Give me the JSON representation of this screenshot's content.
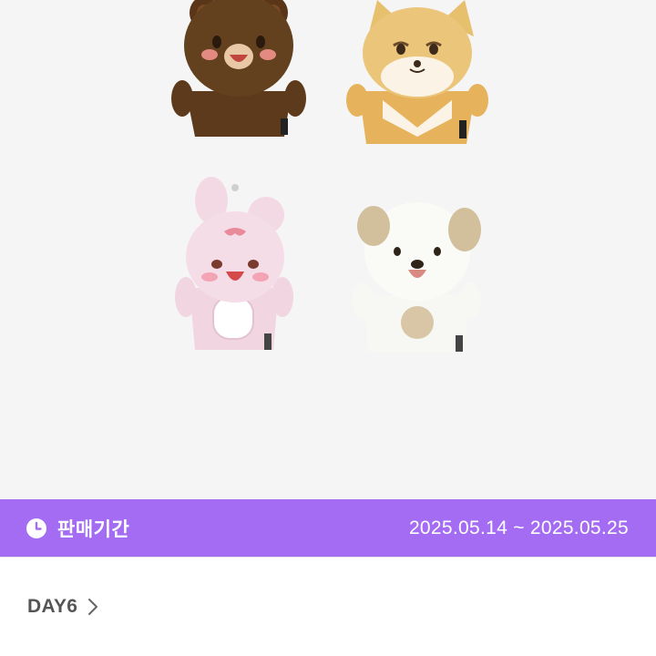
{
  "sale_banner": {
    "icon": "clock-icon",
    "label": "판매기간",
    "dates": "2025.05.14 ~ 2025.05.25",
    "color": "#a46cf2"
  },
  "artist": {
    "name": "DAY6",
    "icon": "chevron-right-icon"
  },
  "product_image": {
    "subject": "four plush keyrings: bear, fox, bunny, puppy",
    "background": "#f5f5f5"
  }
}
